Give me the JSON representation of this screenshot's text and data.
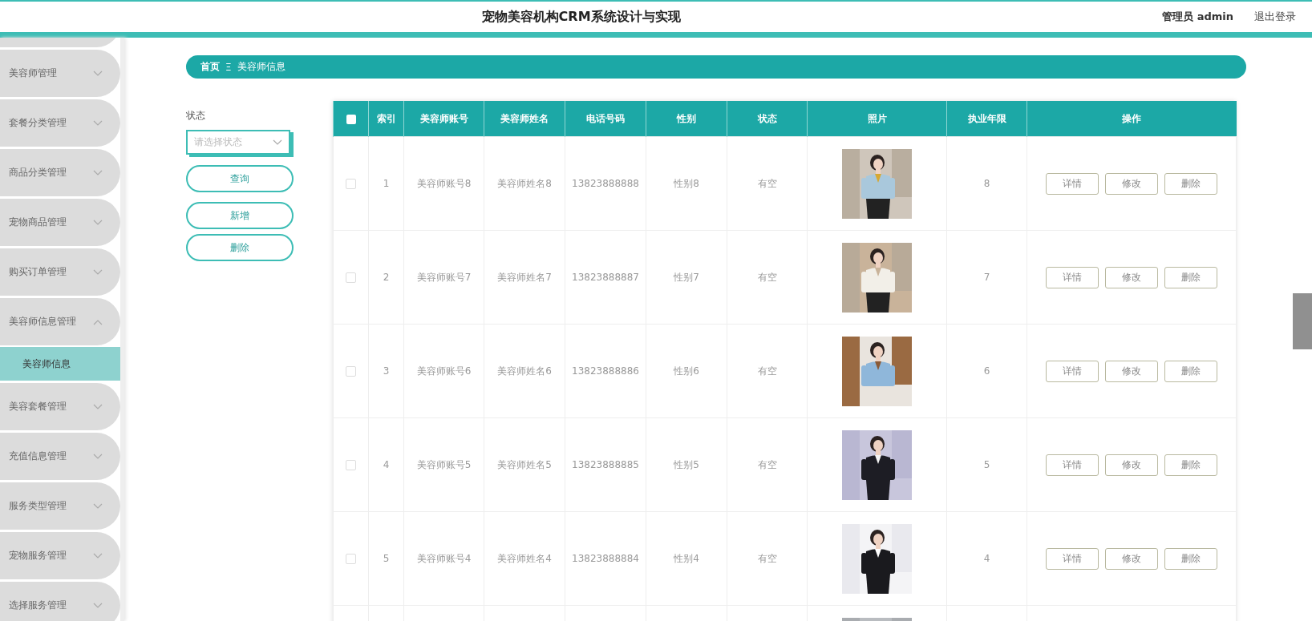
{
  "header": {
    "title": "宠物美容机构CRM系统设计与实现",
    "user": "管理员 admin",
    "logout": "退出登录"
  },
  "sidebar": {
    "items": [
      {
        "label": "美容师管理",
        "expanded": false
      },
      {
        "label": "套餐分类管理",
        "expanded": false
      },
      {
        "label": "商品分类管理",
        "expanded": false
      },
      {
        "label": "宠物商品管理",
        "expanded": false
      },
      {
        "label": "购买订单管理",
        "expanded": false
      },
      {
        "label": "美容师信息管理",
        "expanded": true,
        "children": [
          {
            "label": "美容师信息",
            "selected": true
          }
        ]
      },
      {
        "label": "美容套餐管理",
        "expanded": false
      },
      {
        "label": "充值信息管理",
        "expanded": false
      },
      {
        "label": "服务类型管理",
        "expanded": false
      },
      {
        "label": "宠物服务管理",
        "expanded": false
      },
      {
        "label": "选择服务管理",
        "expanded": false
      }
    ]
  },
  "breadcrumb": {
    "home": "首页",
    "separator": "Ξ",
    "current": "美容师信息"
  },
  "filter": {
    "label": "状态",
    "select": {
      "placeholder": "请选择状态"
    },
    "buttons": [
      "查询",
      "新增",
      "删除"
    ]
  },
  "table": {
    "select_all": {
      "checked": false
    },
    "columns": [
      "索引",
      "美容师账号",
      "美容师姓名",
      "电话号码",
      "性别",
      "状态",
      "照片",
      "执业年限",
      "操作"
    ],
    "rows": [
      {
        "checked": false,
        "index": "1",
        "account": "美容师账号8",
        "name": "美容师姓名8",
        "phone": "13823888888",
        "gender": "性别8",
        "status": "有空",
        "photo": {
          "kind": "picture"
        },
        "years": "8",
        "actions": [
          "详情",
          "修改",
          "删除"
        ]
      },
      {
        "checked": false,
        "index": "2",
        "account": "美容师账号7",
        "name": "美容师姓名7",
        "phone": "13823888887",
        "gender": "性别7",
        "status": "有空",
        "photo": {
          "kind": "picture"
        },
        "years": "7",
        "actions": [
          "详情",
          "修改",
          "删除"
        ]
      },
      {
        "checked": false,
        "index": "3",
        "account": "美容师账号6",
        "name": "美容师姓名6",
        "phone": "13823888886",
        "gender": "性别6",
        "status": "有空",
        "photo": {
          "kind": "picture"
        },
        "years": "6",
        "actions": [
          "详情",
          "修改",
          "删除"
        ]
      },
      {
        "checked": false,
        "index": "4",
        "account": "美容师账号5",
        "name": "美容师姓名5",
        "phone": "13823888885",
        "gender": "性别5",
        "status": "有空",
        "photo": {
          "kind": "picture"
        },
        "years": "5",
        "actions": [
          "详情",
          "修改",
          "删除"
        ]
      },
      {
        "checked": false,
        "index": "5",
        "account": "美容师账号4",
        "name": "美容师姓名4",
        "phone": "13823888884",
        "gender": "性别4",
        "status": "有空",
        "photo": {
          "kind": "picture"
        },
        "years": "4",
        "actions": [
          "详情",
          "修改",
          "删除"
        ]
      },
      {
        "photo": {
          "kind": "picture"
        }
      }
    ]
  }
}
